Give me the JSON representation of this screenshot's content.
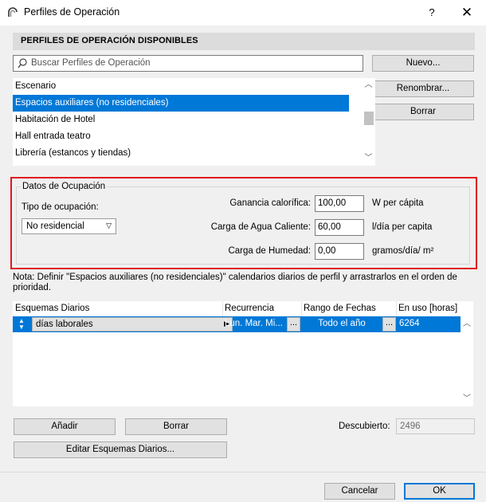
{
  "window": {
    "title": "Perfiles de Operación",
    "help_label": "?",
    "close_label": "✕"
  },
  "profiles": {
    "header": "PERFILES DE OPERACIÓN DISPONIBLES",
    "search_placeholder": "Buscar Perfiles de Operación",
    "items": [
      "Escenario",
      "Espacios auxiliares (no residenciales)",
      "Habitación de Hotel",
      "Hall entrada teatro",
      "Librería (estancos y tiendas)"
    ],
    "selected_item": "Espacios auxiliares (no residenciales)",
    "buttons": {
      "new": "Nuevo...",
      "rename": "Renombrar...",
      "delete": "Borrar"
    }
  },
  "occupancy": {
    "group_title": "Datos de Ocupación",
    "type_label": "Tipo de ocupación:",
    "type_value": "No residencial",
    "heat_gain_label": "Ganancia calorífica:",
    "heat_gain_value": "100,00",
    "heat_gain_unit": "W per cápita",
    "hot_water_label": "Carga de Agua Caliente:",
    "hot_water_value": "60,00",
    "hot_water_unit": "l/día per capita",
    "humidity_label": "Carga de Humedad:",
    "humidity_value": "0,00",
    "humidity_unit": "gramos/día/ m²"
  },
  "note": "Nota: Definir \"Espacios auxiliares (no residenciales)\" calendarios diarios de perfil y arrastrarlos en el orden de prioridad.",
  "schedules": {
    "columns": [
      "Esquemas Diarios",
      "Recurrencia",
      "Rango de Fechas",
      "En uso [horas]"
    ],
    "rows": [
      {
        "name": "días laborales",
        "recurrence": "Lun. Mar. Mi...",
        "date_range": "Todo el año",
        "hours_in_use": "6264"
      }
    ],
    "ellipsis_label": "...",
    "add_button": "Añadir",
    "delete_button": "Borrar",
    "edit_button": "Editar Esquemas Diarios...",
    "uncovered_label": "Descubierto:",
    "uncovered_value": "2496"
  },
  "footer": {
    "cancel": "Cancelar",
    "ok": "OK"
  },
  "colors": {
    "selection": "#0078d7",
    "highlight_frame": "#e0161e",
    "header_bg": "#dcdcdc"
  }
}
